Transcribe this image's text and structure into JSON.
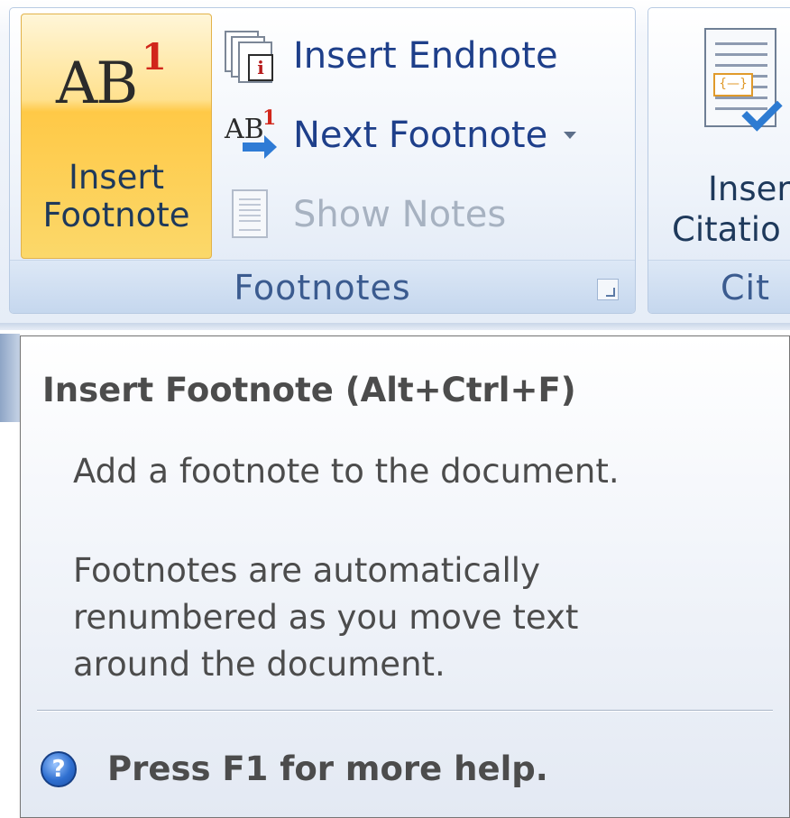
{
  "ribbon": {
    "footnotes_group": {
      "label": "Footnotes",
      "insert_footnote": {
        "icon_main": "AB",
        "icon_sup": "1",
        "label_line1": "Insert",
        "label_line2": "Footnote"
      },
      "insert_endnote": {
        "label": "Insert Endnote",
        "icon": "endnote-icon",
        "icon_text": "i"
      },
      "next_footnote": {
        "label": "Next Footnote",
        "icon": "next-footnote-icon",
        "icon_main": "AB",
        "icon_sup": "1"
      },
      "show_notes": {
        "label": "Show Notes",
        "icon": "show-notes-icon",
        "disabled": true
      }
    },
    "citations_group": {
      "label": "Cit",
      "insert_citation": {
        "label_line1": "Inser",
        "label_line2": "Citatio",
        "icon": "insert-citation-icon",
        "icon_text": "{—}"
      }
    }
  },
  "tooltip": {
    "title": "Insert Footnote (Alt+Ctrl+F)",
    "description": "Add a footnote to the document.",
    "details": "Footnotes are automatically\nrenumbered as you move text\naround the document.",
    "help_icon": "?",
    "help_text": "Press F1 for more help."
  },
  "colors": {
    "hover_button": "#ffc947",
    "label_blue": "#1e3f8a",
    "group_label": "#3b5b8f",
    "disabled_text": "#a7b2c1",
    "tooltip_text": "#4c4c4c"
  }
}
